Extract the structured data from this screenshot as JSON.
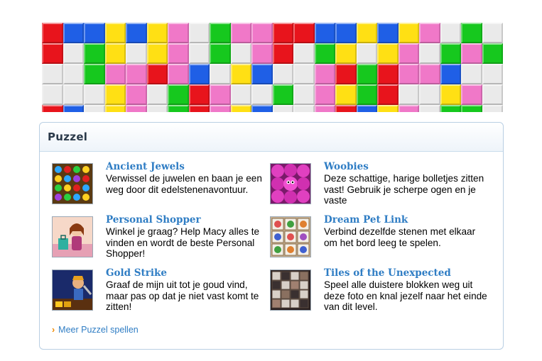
{
  "panel": {
    "title": "Puzzel",
    "games": [
      {
        "title": "Ancient Jewels",
        "description": "Verwissel de juwelen en baan je een weg door dit edelstenenavontuur.",
        "icon": "jewels-thumbnail"
      },
      {
        "title": "Woobies",
        "description": "Deze schattige, harige bolletjes zitten vast! Gebruik je scherpe ogen en je vaste",
        "icon": "woobies-thumbnail"
      },
      {
        "title": "Personal Shopper",
        "description": "Winkel je graag? Help Macy alles te vinden en wordt de beste Personal Shopper!",
        "icon": "shopper-thumbnail"
      },
      {
        "title": "Dream Pet Link",
        "description": "Verbind dezelfde stenen met elkaar om het bord leeg te spelen.",
        "icon": "petlink-thumbnail"
      },
      {
        "title": "Gold Strike",
        "description": "Graaf de mijn uit tot je goud vind, maar pas op dat je niet vast komt te zitten!",
        "icon": "goldstrike-thumbnail"
      },
      {
        "title": "Tiles of the Unexpected",
        "description": "Speel alle duistere blokken weg uit deze foto en knal jezelf naar het einde van dit level.",
        "icon": "tiles-thumbnail"
      }
    ],
    "more_link": "Meer Puzzel spellen",
    "more_icon": "chevron-right-icon"
  },
  "banner": {
    "icon": "colored-tiles-banner",
    "colors": {
      "R": "#e8141c",
      "B": "#1f5fe6",
      "Y": "#ffe014",
      "P": "#f078c8",
      "G": "#16c81e",
      "W": "#eaeaea"
    },
    "rows": [
      "RBBYBYPWGPPRRBBYBYPWGW",
      "RWGYWYPWGWPRWGYWYPWGPG",
      "WWGPPRPBWYBWWPRGRPPBWW",
      "WWWYPWGRPWWGWPYGRWWYPW",
      "RBWYPWGRPYBWWPRBYPWGGW"
    ]
  }
}
